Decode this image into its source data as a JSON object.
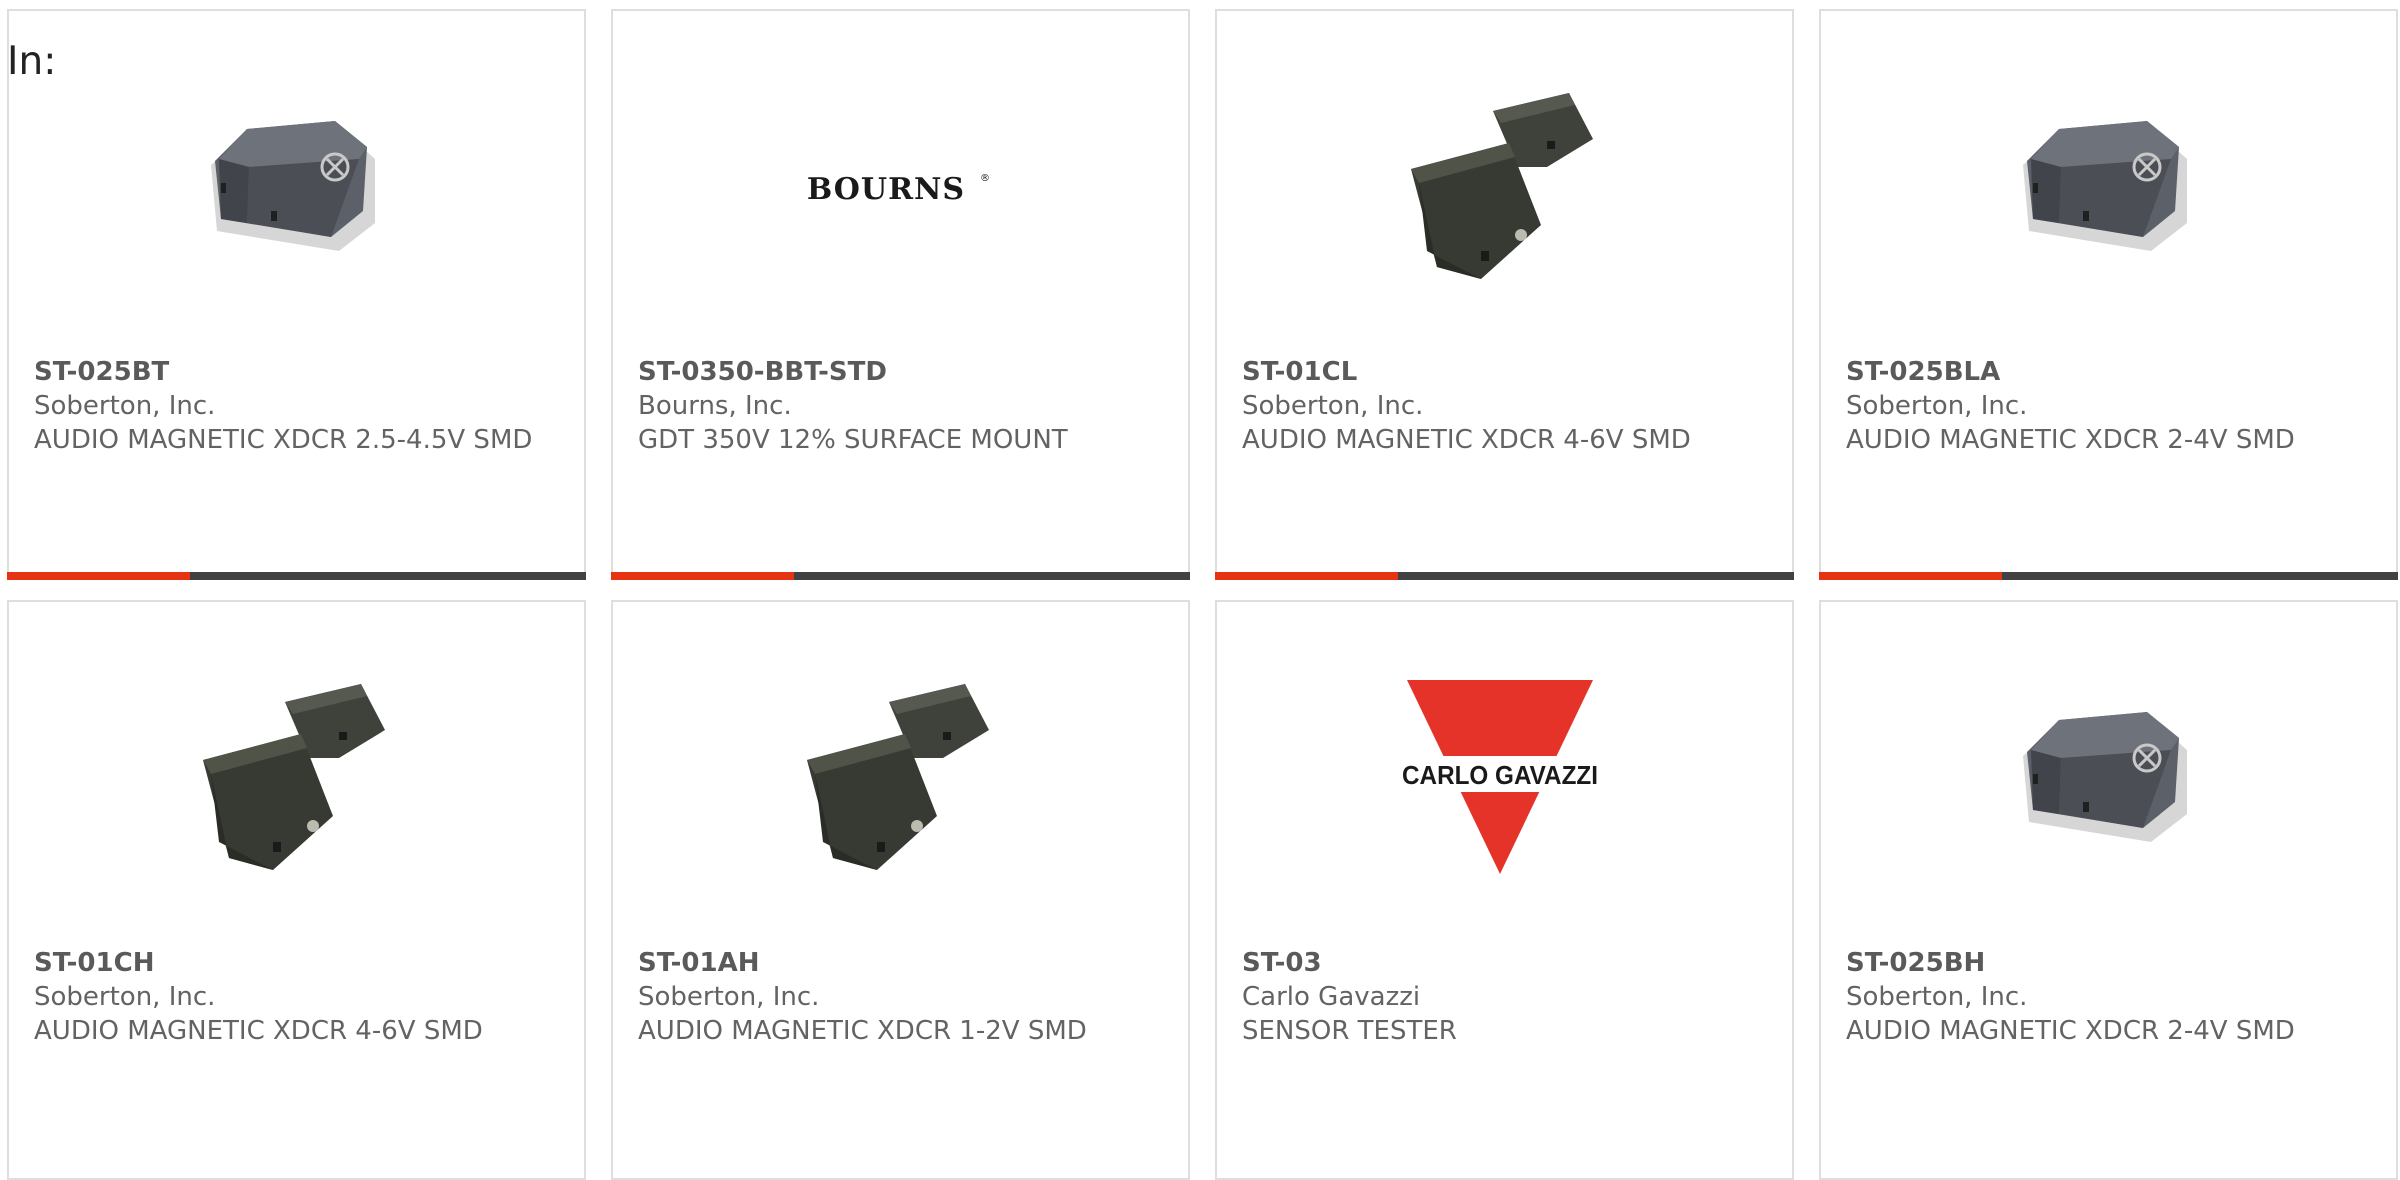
{
  "header": {
    "in_label": "In:"
  },
  "colors": {
    "accent": "#e63312",
    "bar": "#414141",
    "text": "#636363",
    "border": "#dedede"
  },
  "products": [
    {
      "part_number": "ST-025BT",
      "manufacturer": "Soberton, Inc.",
      "description": "AUDIO MAGNETIC XDCR 2.5-4.5V SMD",
      "image": "square-buzzer-icon"
    },
    {
      "part_number": "ST-0350-BBT-STD",
      "manufacturer": "Bourns, Inc.",
      "description": "GDT 350V 12% SURFACE MOUNT",
      "image": "bourns-logo",
      "logo_text": "BOURNS"
    },
    {
      "part_number": "ST-01CL",
      "manufacturer": "Soberton, Inc.",
      "description": "AUDIO MAGNETIC XDCR 4-6V SMD",
      "image": "twin-buzzer-icon"
    },
    {
      "part_number": "ST-025BLA",
      "manufacturer": "Soberton, Inc.",
      "description": "AUDIO MAGNETIC XDCR 2-4V SMD",
      "image": "square-buzzer-icon"
    },
    {
      "part_number": "ST-01CH",
      "manufacturer": "Soberton, Inc.",
      "description": "AUDIO MAGNETIC XDCR 4-6V SMD",
      "image": "twin-buzzer-icon"
    },
    {
      "part_number": "ST-01AH",
      "manufacturer": "Soberton, Inc.",
      "description": "AUDIO MAGNETIC XDCR 1-2V SMD",
      "image": "twin-buzzer-icon"
    },
    {
      "part_number": "ST-03",
      "manufacturer": "Carlo Gavazzi",
      "description": "SENSOR TESTER",
      "image": "carlo-gavazzi-logo",
      "logo_text": "CARLO GAVAZZI"
    },
    {
      "part_number": "ST-025BH",
      "manufacturer": "Soberton, Inc.",
      "description": "AUDIO MAGNETIC XDCR 2-4V SMD",
      "image": "square-buzzer-icon"
    }
  ]
}
